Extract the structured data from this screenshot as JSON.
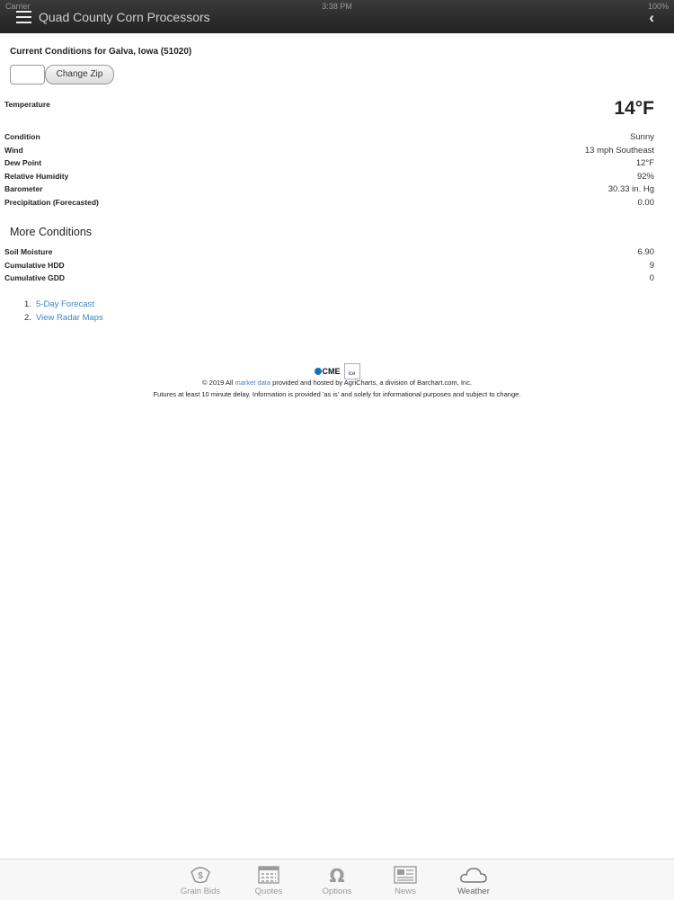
{
  "status": {
    "carrier": "Carrier",
    "time": "3:38 PM",
    "battery": "100%"
  },
  "header": {
    "title": "Quad County Corn Processors"
  },
  "current": {
    "title": "Current Conditions for Galva, Iowa (51020)",
    "zip_value": "",
    "change_zip_label": "Change Zip"
  },
  "conditions": [
    {
      "label": "Temperature",
      "value": "14°F"
    },
    {
      "label": "Condition",
      "value": "Sunny"
    },
    {
      "label": "Wind",
      "value": "13 mph Southeast"
    },
    {
      "label": "Dew Point",
      "value": "12°F"
    },
    {
      "label": "Relative Humidity",
      "value": "92%"
    },
    {
      "label": "Barometer",
      "value": "30.33 in. Hg"
    },
    {
      "label": "Precipitation (Forecasted)",
      "value": "0.00"
    }
  ],
  "more": {
    "title": "More Conditions",
    "rows": [
      {
        "label": "Soil Moisture",
        "value": "6.90"
      },
      {
        "label": "Cumulative HDD",
        "value": "9"
      },
      {
        "label": "Cumulative GDD",
        "value": "0"
      }
    ]
  },
  "links": [
    {
      "num": "1.",
      "label": "5-Day Forecast"
    },
    {
      "num": "2.",
      "label": "View Radar Maps"
    }
  ],
  "footer": {
    "cme": "CME",
    "ice": "ice",
    "line1_pre": "© 2019 All ",
    "line1_link": "market data",
    "line1_post": " provided and hosted by AgriCharts, a division of Barchart.com, Inc.",
    "line2": "Futures at least 10 minute delay. Information is provided 'as is' and solely for informational purposes and subject to change."
  },
  "tabs": [
    {
      "label": "Grain Bids",
      "icon": "grain-bids-icon"
    },
    {
      "label": "Quotes",
      "icon": "quotes-icon"
    },
    {
      "label": "Options",
      "icon": "options-icon"
    },
    {
      "label": "News",
      "icon": "news-icon"
    },
    {
      "label": "Weather",
      "icon": "weather-icon",
      "active": true
    }
  ]
}
